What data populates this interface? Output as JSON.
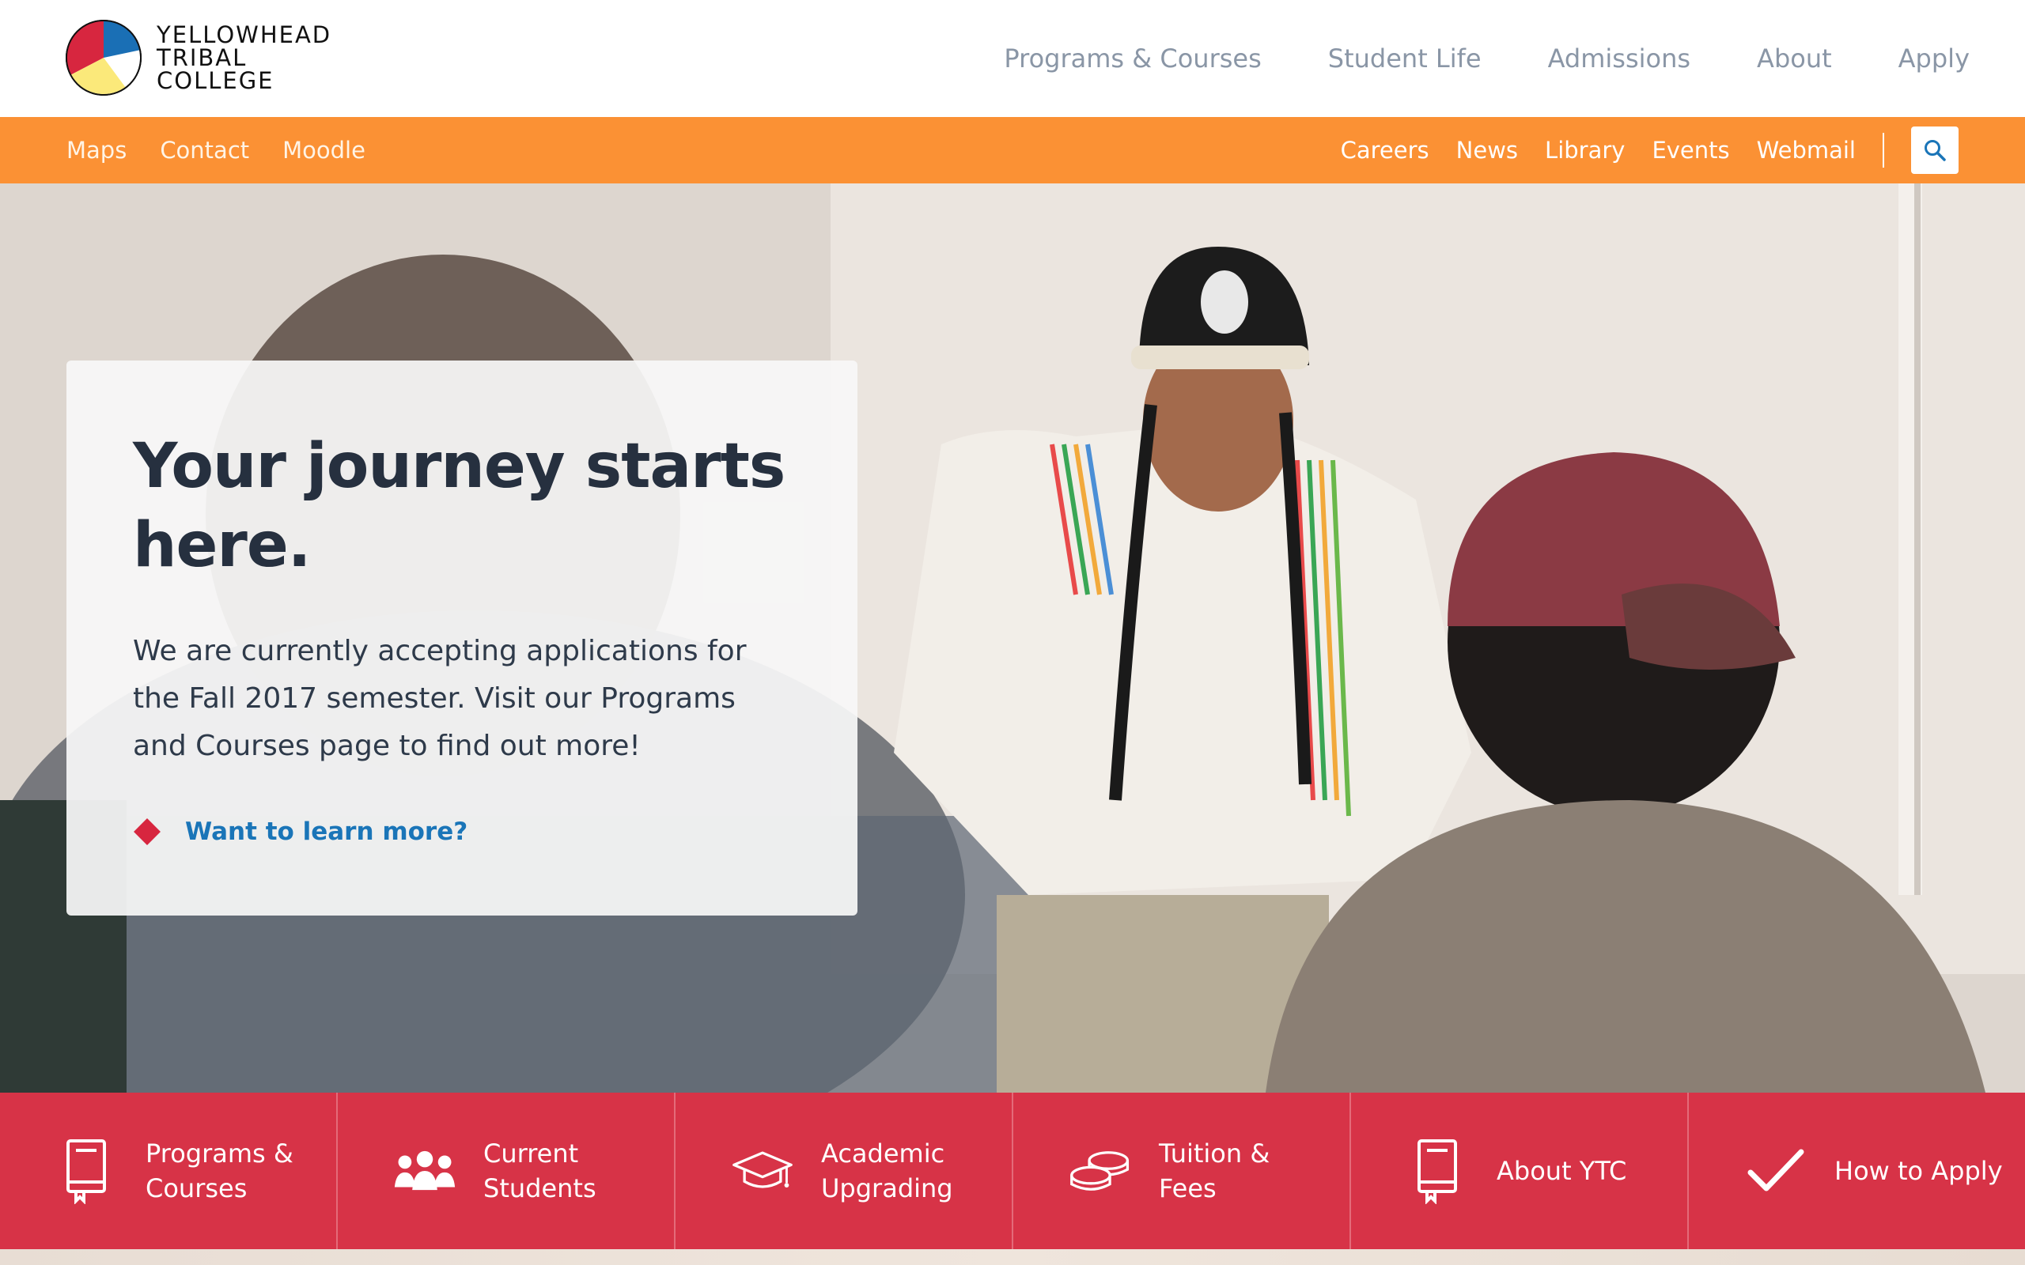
{
  "logo": {
    "lines": [
      "YELLOWHEAD",
      "TRIBAL",
      "COLLEGE"
    ],
    "colors": {
      "blue": "#1a6fb5",
      "red": "#d7263f",
      "yellow": "#fbe97a"
    }
  },
  "main_nav": [
    "Programs & Courses",
    "Student Life",
    "Admissions",
    "About",
    "Apply"
  ],
  "utility_bar": {
    "bg": "#fb9134",
    "left": [
      "Maps",
      "Contact",
      "Moodle"
    ],
    "right": [
      "Careers",
      "News",
      "Library",
      "Events",
      "Webmail"
    ],
    "search_icon": "search-icon"
  },
  "hero": {
    "title": "Your journey starts here.",
    "body": "We are currently accepting applications for the Fall 2017 semester. Visit our Programs and Courses page to find out more!",
    "link": "Want to learn more?"
  },
  "quick_links": [
    {
      "label": "Programs &\nCourses",
      "icon": "book-icon"
    },
    {
      "label": "Current\nStudents",
      "icon": "people-icon"
    },
    {
      "label": "Academic\nUpgrading",
      "icon": "graduation-cap-icon"
    },
    {
      "label": "Tuition &\nFees",
      "icon": "coins-icon"
    },
    {
      "label": "About YTC",
      "icon": "book-icon"
    },
    {
      "label": "How to Apply",
      "icon": "checkmark-icon"
    }
  ],
  "accent": {
    "red": "#d73347",
    "orange": "#fb9134",
    "link_blue": "#1a75b8"
  }
}
